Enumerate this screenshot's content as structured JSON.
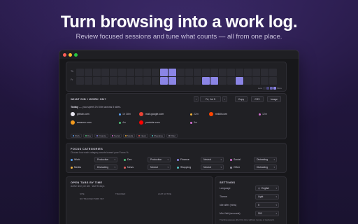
{
  "hero": {
    "title": "Turn browsing into a work log.",
    "subtitle": "Review focused sessions and tune what counts — all from one place."
  },
  "heatmap": {
    "row_labels": [
      "Th",
      "Fr"
    ],
    "highlighted_cells": [
      [
        0,
        10
      ],
      [
        0,
        11
      ],
      [
        1,
        10
      ],
      [
        1,
        11
      ],
      [
        1,
        15
      ],
      [
        1,
        16
      ],
      [
        1,
        19
      ]
    ],
    "legend_less": "Less",
    "legend_more": "More"
  },
  "work": {
    "title": "WHAT DID I WORK ON?",
    "subtitle": "",
    "date_label": "Fri, Jul 5",
    "copy_label": "Copy",
    "csv_label": "CSV",
    "image_label": "Image",
    "today_prefix": "Today",
    "today_text": "— you spent 2h 04m across 5 sites.",
    "sites": [
      {
        "name": "github.com",
        "time": "1h 38m",
        "color": "#e8e6f0",
        "dot": "#5aa0f0"
      },
      {
        "name": "mail.google.com",
        "time": "22m",
        "color": "#ea4335",
        "dot": "#f3b33d"
      },
      {
        "name": "reddit.com",
        "time": "12m",
        "color": "#ff4500",
        "dot": "#d66fd4"
      },
      {
        "name": "amazon.com",
        "time": "4m",
        "color": "#f29a1e",
        "dot": "#4fc27a"
      },
      {
        "name": "youtube.com",
        "time": "5m",
        "color": "#ff0000",
        "dot": "#d66fd4"
      }
    ],
    "categories": [
      {
        "label": "Work",
        "color": "#5aa0f0"
      },
      {
        "label": "Dev",
        "color": "#4fc27a"
      },
      {
        "label": "Finance",
        "color": "#8b85e6"
      },
      {
        "label": "Social",
        "color": "#d66fd4"
      },
      {
        "label": "Media",
        "color": "#f3b33d"
      },
      {
        "label": "News",
        "color": "#e05d5d"
      },
      {
        "label": "Shopping",
        "color": "#4fc2c2"
      },
      {
        "label": "Other",
        "color": "#8d8a98"
      }
    ]
  },
  "focus": {
    "title": "FOCUS CATEGORIES",
    "subtitle": "Choose how each category counts toward your Focus %.",
    "items": [
      {
        "label": "Work",
        "value": "Productive",
        "color": "#5aa0f0"
      },
      {
        "label": "Dev",
        "value": "Productive",
        "color": "#4fc27a"
      },
      {
        "label": "Finance",
        "value": "Neutral",
        "color": "#8b85e6"
      },
      {
        "label": "Social",
        "value": "Distracting",
        "color": "#d66fd4"
      },
      {
        "label": "Media",
        "value": "Distracting",
        "color": "#f3b33d"
      },
      {
        "label": "News",
        "value": "Neutral",
        "color": "#e05d5d"
      },
      {
        "label": "Shopping",
        "value": "Neutral",
        "color": "#4fc2c2"
      },
      {
        "label": "Other",
        "value": "Distracting",
        "color": "#8d8a98"
      }
    ]
  },
  "tabs": {
    "title": "OPEN TABS BY TIME",
    "subtitle": "Active time per site · last 90 days",
    "col_site": "SITE",
    "col_tracked": "TRACKED",
    "col_last": "LAST ACTIVE",
    "empty": "NO TRACKED TABS YET."
  },
  "settings": {
    "title": "SETTINGS",
    "language_label": "Language",
    "language_value": "English",
    "theme_label": "Theme",
    "theme_value": "Light",
    "idle_label": "Idle after (mins)",
    "idle_value": "5",
    "min_label": "Min Visit (seconds)",
    "min_value": "900",
    "note": "Tracking pauses after this time without mouse or keyboard."
  }
}
